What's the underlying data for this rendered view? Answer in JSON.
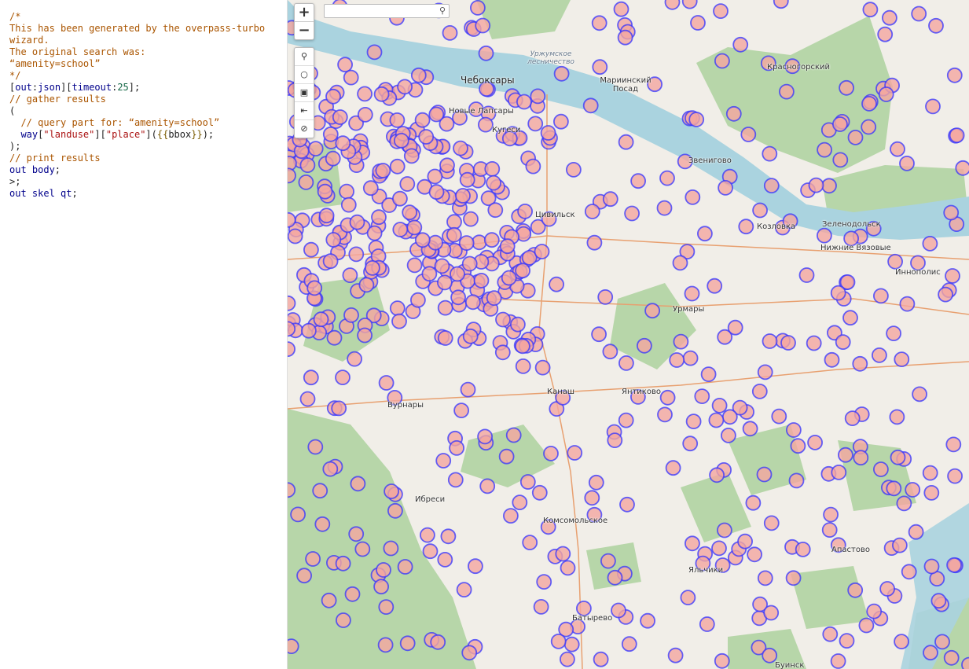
{
  "editor": {
    "lines": [
      [
        {
          "t": "/*",
          "c": "comment"
        }
      ],
      [
        {
          "t": "This has been generated by the overpass-turbo",
          "c": "comment"
        }
      ],
      [
        {
          "t": "wizard.",
          "c": "comment"
        }
      ],
      [
        {
          "t": "The original search was:",
          "c": "comment"
        }
      ],
      [
        {
          "t": "“amenity=school”",
          "c": "comment"
        }
      ],
      [
        {
          "t": "*/",
          "c": "comment"
        }
      ],
      [
        {
          "t": "[",
          "c": "plain"
        },
        {
          "t": "out",
          "c": "key"
        },
        {
          "t": ":",
          "c": "plain"
        },
        {
          "t": "json",
          "c": "key"
        },
        {
          "t": "][",
          "c": "plain"
        },
        {
          "t": "timeout",
          "c": "key"
        },
        {
          "t": ":",
          "c": "plain"
        },
        {
          "t": "25",
          "c": "num"
        },
        {
          "t": "];",
          "c": "plain"
        }
      ],
      [
        {
          "t": "// gather results",
          "c": "comment"
        }
      ],
      [
        {
          "t": "(",
          "c": "plain"
        }
      ],
      [
        {
          "t": "  // query part for: “amenity=school”",
          "c": "comment"
        }
      ],
      [
        {
          "t": "  way",
          "c": "key"
        },
        {
          "t": "[",
          "c": "plain"
        },
        {
          "t": "\"landuse\"",
          "c": "str"
        },
        {
          "t": "][",
          "c": "plain"
        },
        {
          "t": "\"place\"",
          "c": "str"
        },
        {
          "t": "](",
          "c": "plain"
        },
        {
          "t": "{{",
          "c": "tmpl"
        },
        {
          "t": "bbox",
          "c": "plain"
        },
        {
          "t": "}}",
          "c": "tmpl"
        },
        {
          "t": ");",
          "c": "plain"
        }
      ],
      [
        {
          "t": ");",
          "c": "plain"
        }
      ],
      [
        {
          "t": "// print results",
          "c": "comment"
        }
      ],
      [
        {
          "t": "out body",
          "c": "key"
        },
        {
          "t": ";",
          "c": "plain"
        }
      ],
      [
        {
          "t": ">;",
          "c": "plain"
        }
      ],
      [
        {
          "t": "out skel qt",
          "c": "key"
        },
        {
          "t": ";",
          "c": "plain"
        }
      ]
    ]
  },
  "map": {
    "zoom_in": "+",
    "zoom_out": "−",
    "search_placeholder": "",
    "labels": {
      "cheboksary": "Чебоксары",
      "urzhum": "Уржумское лесничество",
      "mariinsky": "Мариинский Посад",
      "krasnogorsky": "Красногорский",
      "novye_lapsary": "Новые Лапсары",
      "kugesi": "Кугеси",
      "zvenigovo": "Звенигово",
      "tsivilsk": "Цивильск",
      "kozlovka": "Козловка",
      "zelenodolsk": "Зеленодольск",
      "nizhnie_vyazovye": "Нижние Вязовые",
      "innopolis": "Иннополис",
      "urmary": "Урмары",
      "kanash": "Канаш",
      "yantikovo": "Янтиково",
      "vurnary": "Вурнары",
      "ibresi": "Ибреси",
      "komsomolskoe": "Комсомольское",
      "apastovo": "Апастово",
      "yalchiki": "Яльчики",
      "batyrevo": "Батырево",
      "buinsk": "Буинск"
    },
    "colors": {
      "marker_fill": "#f4a6a0",
      "marker_stroke": "#3333ff",
      "forest": "#add19e",
      "water": "#aad3df",
      "land": "#f1eee8"
    },
    "tool_icons": [
      "search-icon",
      "circle-icon",
      "image-icon",
      "exit-icon",
      "cancel-icon"
    ]
  }
}
